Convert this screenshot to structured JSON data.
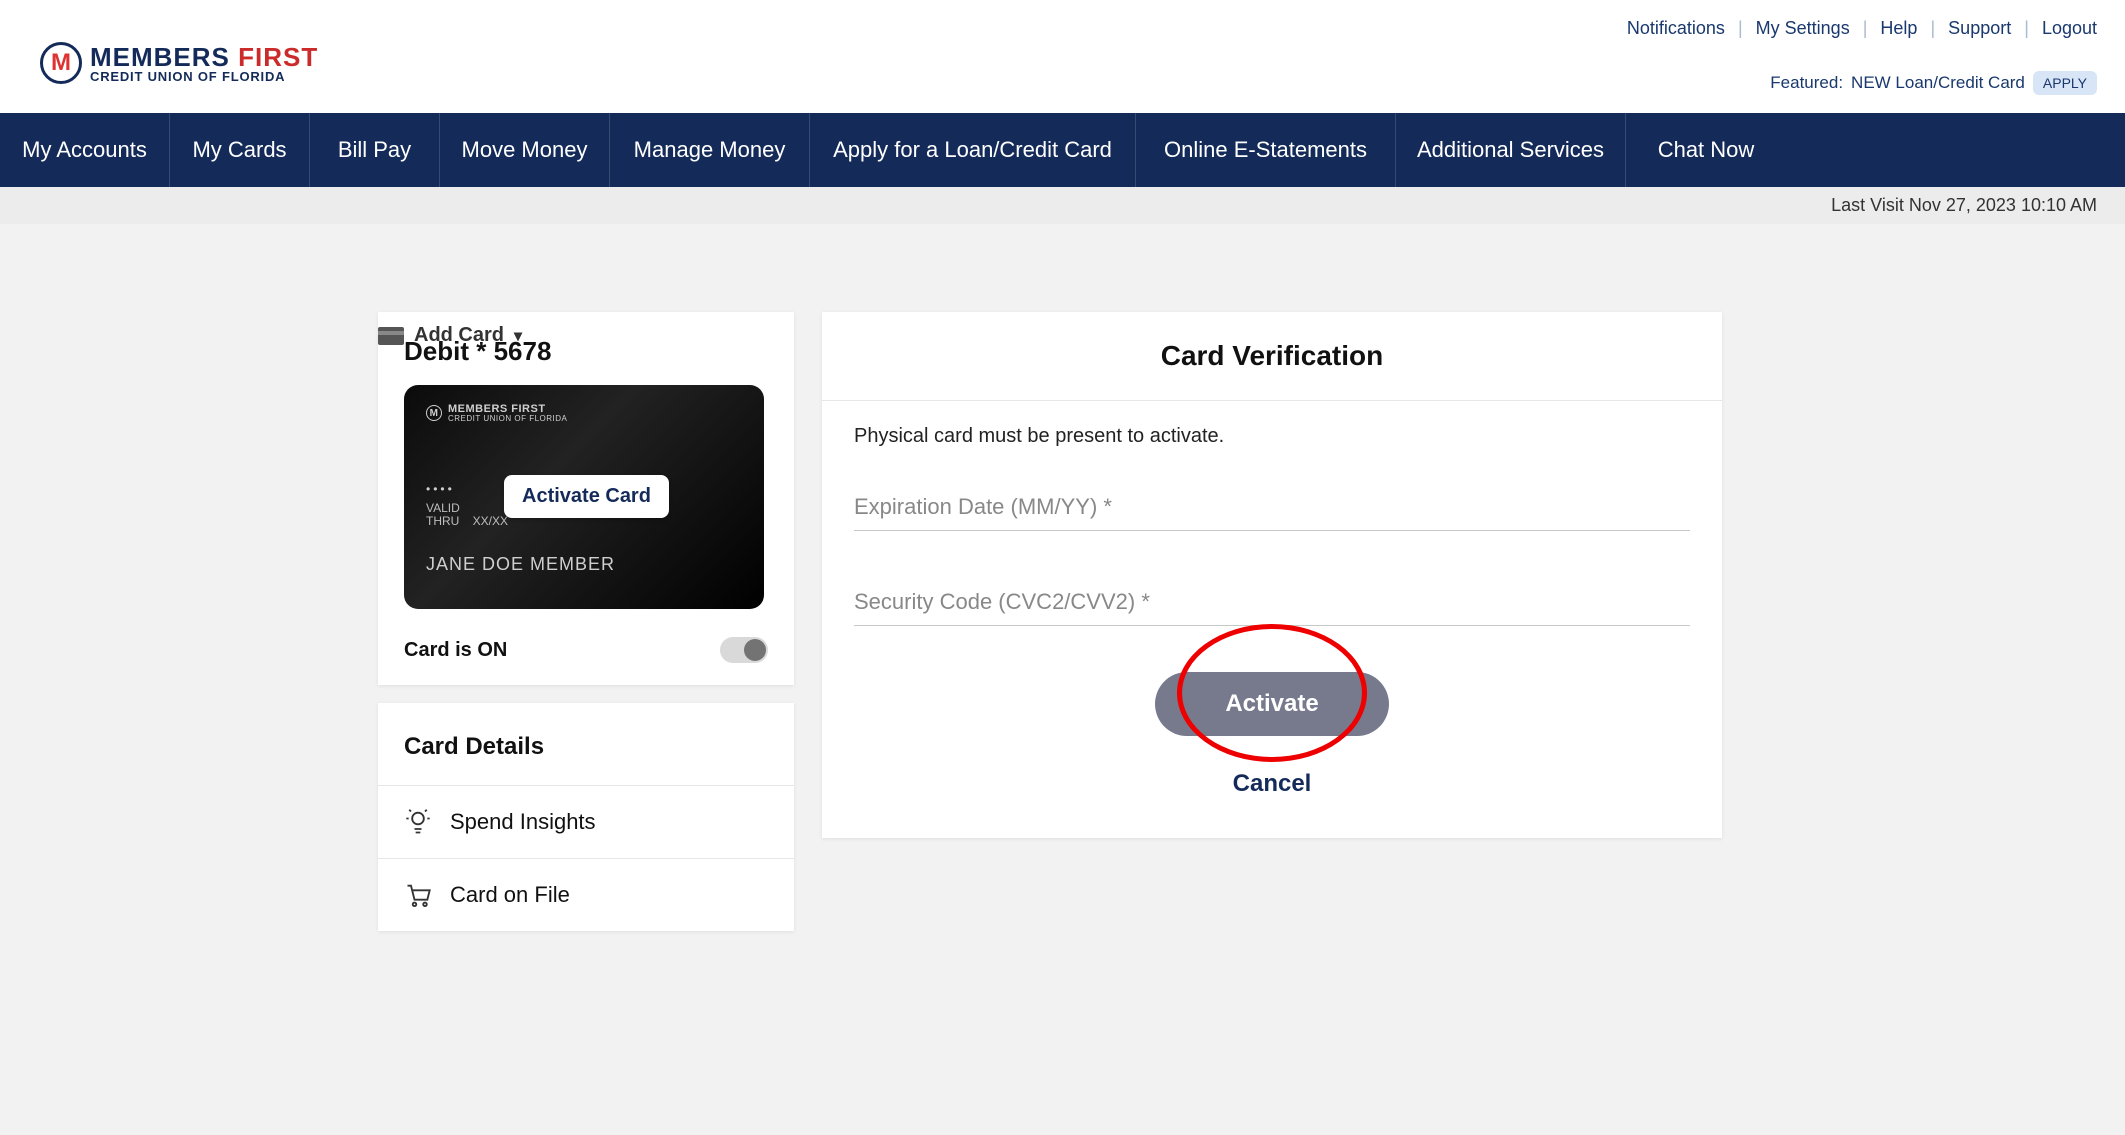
{
  "header": {
    "logo": {
      "line1_a": "MEMBERS ",
      "line1_b": "FIRST",
      "line2": "CREDIT UNION OF FLORIDA",
      "badge_letter": "M"
    },
    "top_links": [
      "Notifications",
      "My Settings",
      "Help",
      "Support",
      "Logout"
    ],
    "featured_label": "Featured:",
    "featured_text": "NEW Loan/Credit Card",
    "apply_label": "APPLY"
  },
  "nav": {
    "items": [
      "My Accounts",
      "My Cards",
      "Bill Pay",
      "Move Money",
      "Manage Money",
      "Apply for a Loan/Credit Card",
      "Online E-Statements",
      "Additional Services",
      "Chat Now"
    ]
  },
  "last_visit": "Last Visit Nov 27, 2023 10:10 AM",
  "add_card_label": "Add Card",
  "card": {
    "title": "Debit * 5678",
    "cc_brand_l1": "MEMBERS FIRST",
    "cc_brand_l2": "CREDIT UNION OF FLORIDA",
    "cc_dots": "••••",
    "cc_valid": "VALID\nTHRU",
    "cc_exp_mask": "XX/XX",
    "cc_name": "JANE DOE MEMBER",
    "activate_badge": "Activate Card",
    "status_label": "Card is ON"
  },
  "details": {
    "title": "Card Details",
    "items": [
      "Spend Insights",
      "Card on File"
    ]
  },
  "verify": {
    "title": "Card Verification",
    "note": "Physical card must be present to activate.",
    "exp_placeholder": "Expiration Date (MM/YY) *",
    "cvv_placeholder": "Security Code (CVC2/CVV2) *",
    "activate_btn": "Activate",
    "cancel": "Cancel"
  }
}
